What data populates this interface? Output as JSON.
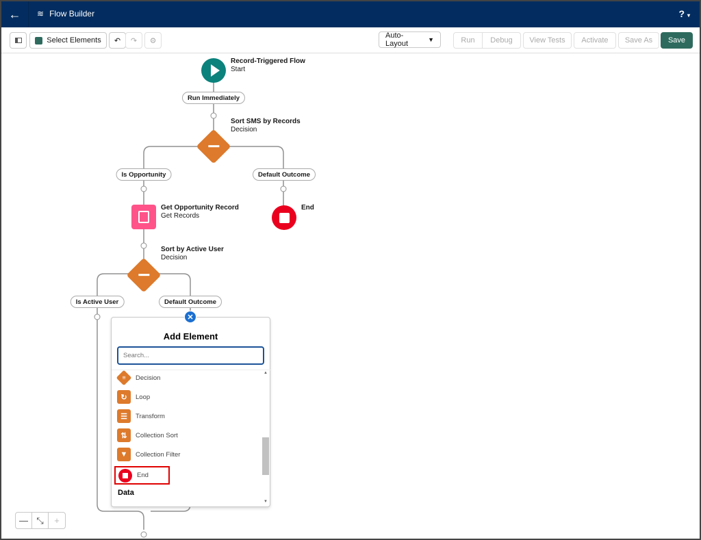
{
  "header": {
    "title": "Flow Builder",
    "help_label": "?"
  },
  "toolbar": {
    "select_elements": "Select Elements",
    "layout": "Auto-Layout",
    "run": "Run",
    "debug": "Debug",
    "view_tests": "View Tests",
    "activate": "Activate",
    "save_as": "Save As",
    "save": "Save"
  },
  "colors": {
    "header": "#032d60",
    "save": "#2e6b5e",
    "start": "#0b827c",
    "decision": "#dd7a2c",
    "get_records": "#ff538a",
    "end": "#ea001e",
    "highlight": "#e00000"
  },
  "flow": {
    "start": {
      "title": "Record-Triggered Flow",
      "type": "Start"
    },
    "run_immediately": "Run Immediately",
    "decision1": {
      "title": "Sort SMS by Records",
      "type": "Decision"
    },
    "outcome_opportunity": "Is Opportunity",
    "outcome_default1": "Default Outcome",
    "get_records": {
      "title": "Get Opportunity Record",
      "type": "Get Records"
    },
    "end": {
      "title": "End"
    },
    "decision2": {
      "title": "Sort by Active User",
      "type": "Decision"
    },
    "outcome_active": "Is Active User",
    "outcome_default2": "Default Outcome"
  },
  "add_element": {
    "title": "Add Element",
    "search_placeholder": "Search...",
    "items": [
      {
        "label": "Decision",
        "icon": "decision-icon"
      },
      {
        "label": "Loop",
        "icon": "loop-icon"
      },
      {
        "label": "Transform",
        "icon": "transform-icon"
      },
      {
        "label": "Collection Sort",
        "icon": "sort-icon"
      },
      {
        "label": "Collection Filter",
        "icon": "filter-icon"
      },
      {
        "label": "End",
        "icon": "end-icon",
        "highlighted": true
      }
    ],
    "section": "Data"
  },
  "zoom": {
    "out": "—",
    "fit": "⤡",
    "in": "+"
  }
}
